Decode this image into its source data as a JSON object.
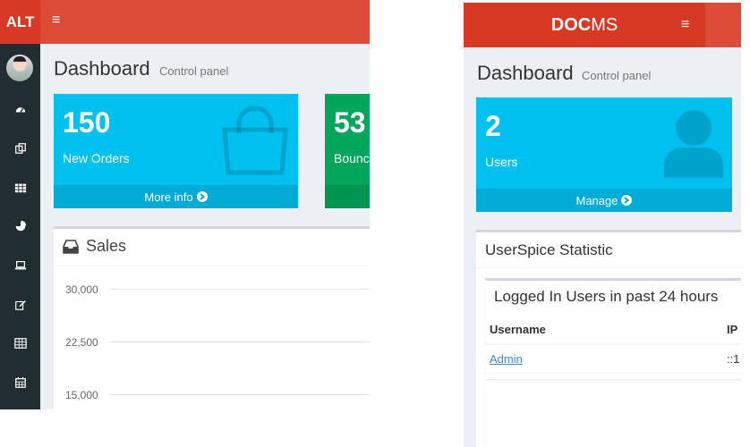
{
  "left": {
    "logo": "ALT",
    "hamburger": "≡",
    "sidebar_icons": [
      "dashboard-icon",
      "files-icon",
      "th-icon",
      "pie-chart-icon",
      "laptop-icon",
      "edit-icon",
      "table-icon",
      "calendar-icon"
    ],
    "title": "Dashboard",
    "subtitle": "Control panel",
    "boxes": [
      {
        "number": "150",
        "label": "New Orders",
        "footer": "More info",
        "color": "#00c0ef"
      },
      {
        "number": "53",
        "label": "Bounc",
        "color": "#00a65a"
      }
    ],
    "sales": {
      "title": "Sales",
      "y_ticks": [
        "30,000",
        "22,500",
        "15,000"
      ]
    }
  },
  "right": {
    "logo_bold": "DOC",
    "logo_rest": "MS",
    "hamburger": "≡",
    "title": "Dashboard",
    "subtitle": "Control panel",
    "box": {
      "number": "2",
      "label": "Users",
      "footer": "Manage",
      "color": "#00c0ef"
    },
    "statistic_title": "UserSpice Statistic",
    "logged_title": "Logged In Users in past 24 hours",
    "table": {
      "headers": [
        "Username",
        "IP"
      ],
      "rows": [
        [
          "Admin",
          "::1"
        ]
      ]
    }
  }
}
